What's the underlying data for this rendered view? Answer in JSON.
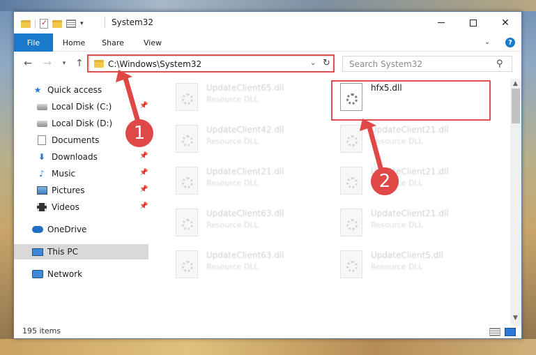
{
  "window": {
    "title": "System32"
  },
  "ribbon": {
    "tabs": [
      "File",
      "Home",
      "Share",
      "View"
    ],
    "help": "?"
  },
  "navbar": {
    "address": "C:\\Windows\\System32",
    "search_placeholder": "Search System32"
  },
  "sidebar": {
    "items": [
      {
        "label": "Quick access",
        "icon": "star-icon",
        "pinned": false
      },
      {
        "label": "Local Disk (C:)",
        "icon": "drive-icon",
        "pinned": true
      },
      {
        "label": "Local Disk (D:)",
        "icon": "drive-icon",
        "pinned": false
      },
      {
        "label": "Documents",
        "icon": "documents-icon",
        "pinned": true
      },
      {
        "label": "Downloads",
        "icon": "download-icon",
        "pinned": true
      },
      {
        "label": "Music",
        "icon": "music-icon",
        "pinned": true
      },
      {
        "label": "Pictures",
        "icon": "pictures-icon",
        "pinned": true
      },
      {
        "label": "Videos",
        "icon": "videos-icon",
        "pinned": true
      },
      {
        "label": "OneDrive",
        "icon": "onedrive-icon",
        "pinned": false
      },
      {
        "label": "This PC",
        "icon": "this-pc-icon",
        "pinned": false,
        "selected": true
      },
      {
        "label": "Network",
        "icon": "network-icon",
        "pinned": false
      }
    ]
  },
  "files": [
    {
      "name": "UpdateClient65.dll",
      "type": "Resource DLL"
    },
    {
      "name": "hfx5.dll",
      "type": ""
    },
    {
      "name": "UpdateClient42.dll",
      "type": "Resource DLL"
    },
    {
      "name": "UpdateClient21.dll",
      "type": "Resource DLL"
    },
    {
      "name": "UpdateClient21.dll",
      "type": "Resource DLL"
    },
    {
      "name": "UpdateClient21.dll",
      "type": "Resource DLL"
    },
    {
      "name": "UpdateClient63.dll",
      "type": "Resource DLL"
    },
    {
      "name": "UpdateClient21.dll",
      "type": "Resource DLL"
    },
    {
      "name": "UpdateClient63.dll",
      "type": "Resource DLL"
    },
    {
      "name": "UpdateClient5.dll",
      "type": "Resource DLL"
    }
  ],
  "status": {
    "item_count": "195 items"
  },
  "annotations": {
    "step1": "1",
    "step2": "2",
    "accent": "#e04848"
  }
}
